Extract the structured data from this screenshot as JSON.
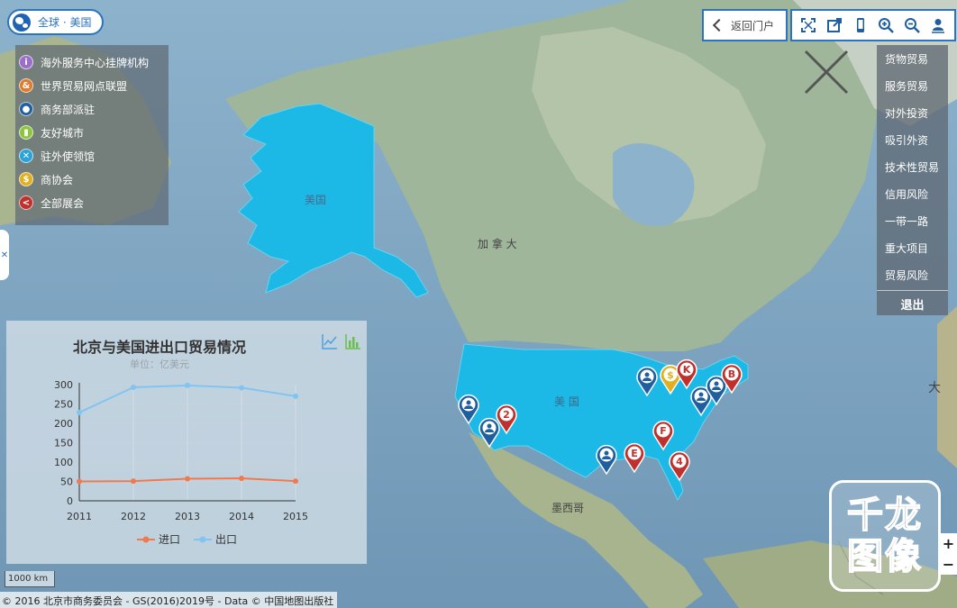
{
  "location": {
    "label": "全球 · 美国",
    "icon": "globe-icon"
  },
  "legend": {
    "items": [
      {
        "label": "海外服务中心挂牌机构",
        "icon": "info-icon",
        "glyph": "i",
        "color": "#9b6fc8"
      },
      {
        "label": "世界贸易网点联盟",
        "icon": "ampersand-icon",
        "glyph": "&",
        "color": "#e07a2c"
      },
      {
        "label": "商务部派驻",
        "icon": "person-icon",
        "glyph": "●",
        "color": "#1f5f9f"
      },
      {
        "label": "友好城市",
        "icon": "building-icon",
        "glyph": "▮",
        "color": "#8cc63f"
      },
      {
        "label": "驻外使领馆",
        "icon": "consulate-icon",
        "glyph": "✕",
        "color": "#29a3d8"
      },
      {
        "label": "商协会",
        "icon": "dollar-icon",
        "glyph": "$",
        "color": "#e0b020"
      },
      {
        "label": "全部展会",
        "icon": "share-icon",
        "glyph": "<",
        "color": "#c0302c"
      }
    ]
  },
  "toolbar": {
    "back_label": "返回门户",
    "tools": [
      "fullscreen-icon",
      "export-icon",
      "mobile-icon",
      "zoom-in-icon",
      "zoom-out-icon",
      "locate-user-icon"
    ]
  },
  "right_menu": {
    "items": [
      "货物贸易",
      "服务贸易",
      "对外投资",
      "吸引外资",
      "技术性贸易",
      "信用风险",
      "一带一路",
      "重大项目",
      "贸易风险"
    ],
    "exit_label": "退出"
  },
  "map_labels": {
    "usa_alaska": "美国",
    "canada": "加 拿 大",
    "usa_main": "美 国",
    "mexico": "墨西哥",
    "da": "大"
  },
  "markers": [
    {
      "type": "person",
      "label": ""
    },
    {
      "type": "person",
      "label": ""
    },
    {
      "type": "letter",
      "label": "2"
    },
    {
      "type": "person",
      "label": ""
    },
    {
      "type": "letter",
      "label": "E"
    },
    {
      "type": "letter",
      "label": "F"
    },
    {
      "type": "letter",
      "label": "4"
    },
    {
      "type": "dollar",
      "label": "$"
    },
    {
      "type": "letter",
      "label": "K"
    },
    {
      "type": "person",
      "label": ""
    },
    {
      "type": "person",
      "label": ""
    },
    {
      "type": "person",
      "label": ""
    },
    {
      "type": "letter",
      "label": "B"
    }
  ],
  "chart_data": {
    "type": "line",
    "title": "北京与美国进出口贸易情况",
    "subtitle": "单位：亿美元",
    "categories": [
      "2011",
      "2012",
      "2013",
      "2014",
      "2015"
    ],
    "series": [
      {
        "name": "进口",
        "values": [
          50,
          51,
          57,
          58,
          51
        ],
        "color": "#f07a50"
      },
      {
        "name": "出口",
        "values": [
          228,
          293,
          298,
          292,
          270
        ],
        "color": "#80c4f2"
      }
    ],
    "ylim": [
      0,
      300
    ],
    "yticks": [
      "0",
      "50",
      "100",
      "150",
      "200",
      "250",
      "300"
    ],
    "grid": true,
    "legend_position": "bottom"
  },
  "scale": "1000 km",
  "copyright": "© 2016 北京市商务委员会 - GS(2016)2019号 - Data © 中国地图出版社",
  "watermark": {
    "line1": "千龙",
    "line2": "图像"
  },
  "zoom": {
    "plus": "+",
    "minus": "−"
  }
}
